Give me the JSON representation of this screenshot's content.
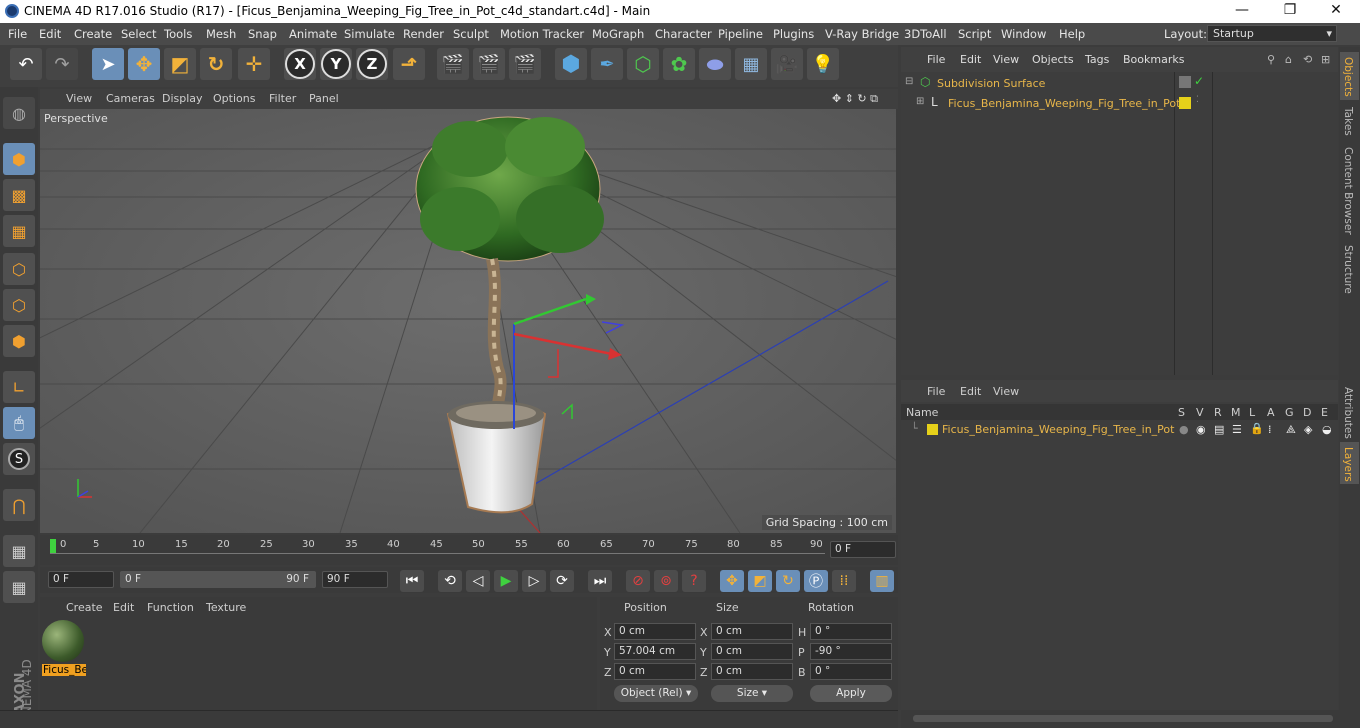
{
  "window": {
    "title": "CINEMA 4D R17.016 Studio (R17) - [Ficus_Benjamina_Weeping_Fig_Tree_in_Pot_c4d_standart.c4d] - Main",
    "min": "—",
    "max": "❐",
    "close": "✕"
  },
  "menu": {
    "items": [
      "File",
      "Edit",
      "Create",
      "Select",
      "Tools",
      "Mesh",
      "Snap",
      "Animate",
      "Simulate",
      "Render",
      "Sculpt",
      "Motion Tracker",
      "MoGraph",
      "Character",
      "Pipeline",
      "Plugins",
      "V-Ray Bridge",
      "3DToAll",
      "Script",
      "Window",
      "Help"
    ],
    "layout_label": "Layout:",
    "layout_value": "Startup"
  },
  "toolbar": {
    "x": "X",
    "y": "Y",
    "z": "Z"
  },
  "viewport": {
    "menu": [
      "View",
      "Cameras",
      "Display",
      "Options",
      "Filter",
      "Panel"
    ],
    "label": "Perspective",
    "grid_spacing": "Grid Spacing : 100 cm"
  },
  "timeline": {
    "ticks": [
      "0",
      "5",
      "10",
      "15",
      "20",
      "25",
      "30",
      "35",
      "40",
      "45",
      "50",
      "55",
      "60",
      "65",
      "70",
      "75",
      "80",
      "85",
      "90"
    ],
    "end_frame": "0 F"
  },
  "transport": {
    "current": "0 F",
    "range_start": "0 F",
    "range_end": "90 F",
    "end": "90 F"
  },
  "material": {
    "menu": [
      "Create",
      "Edit",
      "Function",
      "Texture"
    ],
    "name": "Ficus_Be"
  },
  "coords": {
    "headers": [
      "Position",
      "Size",
      "Rotation"
    ],
    "rows": [
      {
        "axis": "X",
        "pos": "0 cm",
        "saxis": "X",
        "size": "0 cm",
        "raxis": "H",
        "rot": "0 °"
      },
      {
        "axis": "Y",
        "pos": "57.004 cm",
        "saxis": "Y",
        "size": "0 cm",
        "raxis": "P",
        "rot": "-90 °"
      },
      {
        "axis": "Z",
        "pos": "0 cm",
        "saxis": "Z",
        "size": "0 cm",
        "raxis": "B",
        "rot": "0 °"
      }
    ],
    "mode": "Object (Rel)",
    "size_mode": "Size",
    "apply": "Apply"
  },
  "objects": {
    "menu": [
      "File",
      "Edit",
      "View",
      "Objects",
      "Tags",
      "Bookmarks"
    ],
    "items": [
      {
        "name": "Subdivision Surface"
      },
      {
        "name": "Ficus_Benjamina_Weeping_Fig_Tree_in_Pot"
      }
    ]
  },
  "layers": {
    "menu": [
      "File",
      "Edit",
      "View"
    ],
    "col_name": "Name",
    "cols": [
      "S",
      "V",
      "R",
      "M",
      "L",
      "A",
      "G",
      "D",
      "E"
    ],
    "row": "Ficus_Benjamina_Weeping_Fig_Tree_in_Pot"
  },
  "side_tabs": [
    "Objects",
    "Takes",
    "Content Browser",
    "Structure",
    "Attributes",
    "Layers"
  ],
  "brand": {
    "a": "MAXON",
    "b": "CINEMA 4D"
  },
  "colors": {
    "accent": "#6a8fb8",
    "object_name": "#e8b64a",
    "layer_yellow": "#e6d11a"
  }
}
